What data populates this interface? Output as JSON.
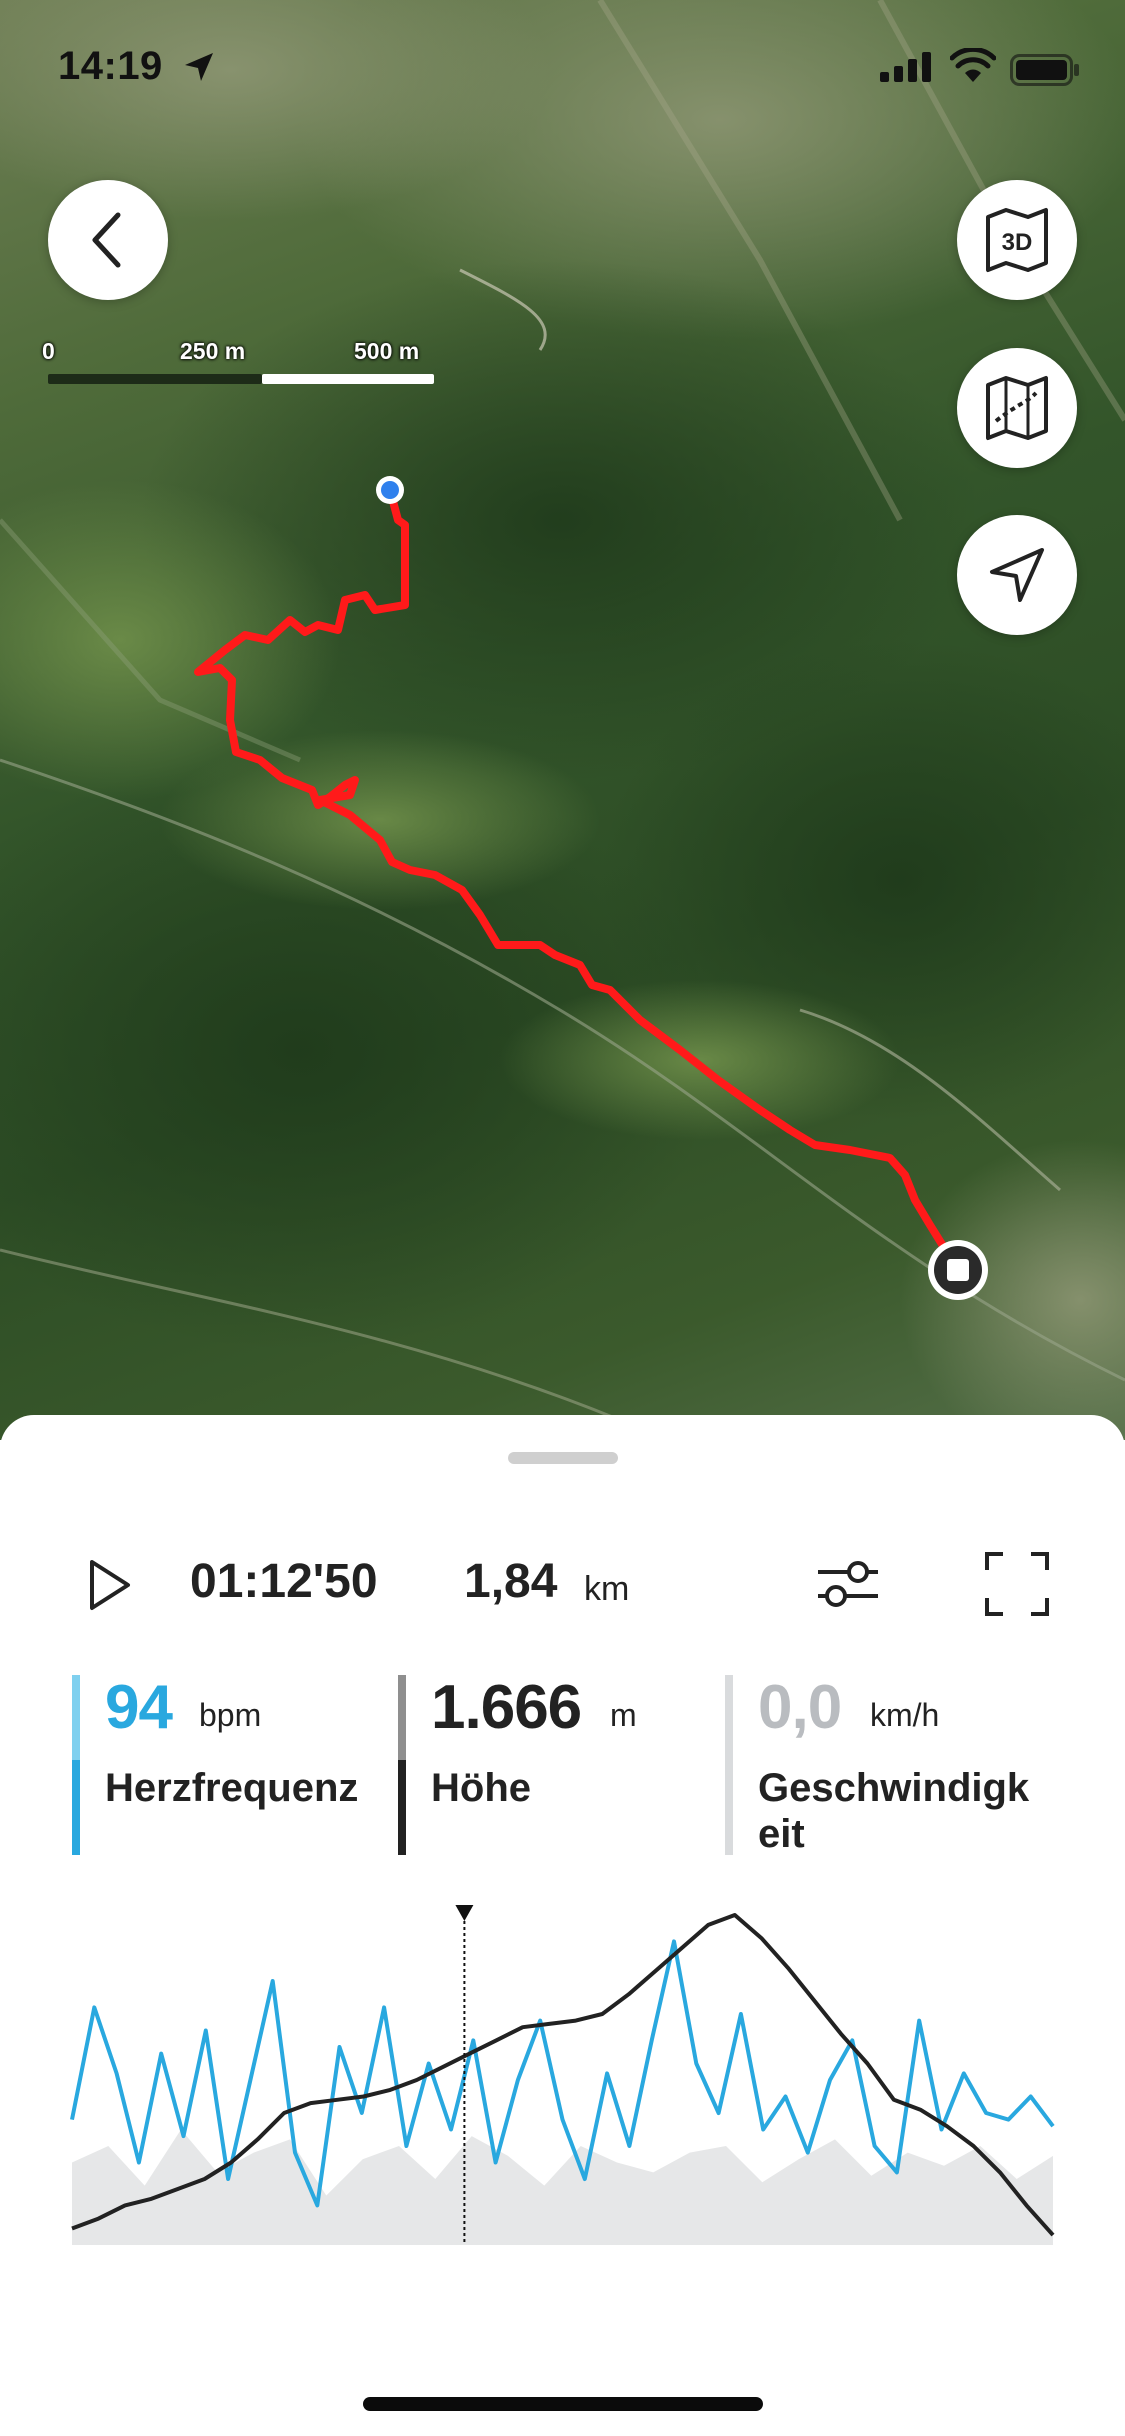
{
  "status_bar": {
    "time": "14:19",
    "location_icon": "location-arrow-icon",
    "signal_icon": "cellular-signal-icon",
    "wifi_icon": "wifi-icon",
    "battery_icon": "battery-icon"
  },
  "map": {
    "back_icon": "chevron-left-icon",
    "button_3d_label": "3D",
    "map_type_icon": "map-icon",
    "locate_icon": "navigation-arrow-icon",
    "scale_labels": [
      "0",
      "250 m",
      "500 m"
    ],
    "route_color": "#ff1a1a",
    "start_marker_color": "#2f80ed",
    "end_marker_icon": "stop-icon"
  },
  "playback": {
    "play_icon": "play-icon",
    "duration": "01:12'50",
    "distance": "1,84",
    "distance_unit": "km",
    "settings_icon": "sliders-icon",
    "fullscreen_icon": "fullscreen-icon"
  },
  "metrics": [
    {
      "value": "94",
      "unit": "bpm",
      "label": "Herzfrequenz",
      "color": "#29a8df"
    },
    {
      "value": "1.666",
      "unit": "m",
      "label": "Höhe",
      "color": "#222222"
    },
    {
      "value": "0,0",
      "unit": "km/h",
      "label": "Geschwindigkeit",
      "color": "#b9bcc0"
    }
  ],
  "chart_data": {
    "type": "line",
    "series": [
      {
        "values": [
          0.05,
          0.08,
          0.12,
          0.14,
          0.17,
          0.2,
          0.25,
          0.32,
          0.4,
          0.43,
          0.44,
          0.45,
          0.47,
          0.5,
          0.54,
          0.58,
          0.62,
          0.66,
          0.67,
          0.68,
          0.7,
          0.76,
          0.83,
          0.9,
          0.97,
          1.0,
          0.93,
          0.84,
          0.74,
          0.64,
          0.55,
          0.44,
          0.41,
          0.36,
          0.3,
          0.22,
          0.12,
          0.03
        ]
      },
      {
        "values": [
          0.38,
          0.72,
          0.52,
          0.25,
          0.58,
          0.33,
          0.65,
          0.2,
          0.5,
          0.8,
          0.28,
          0.12,
          0.6,
          0.4,
          0.72,
          0.3,
          0.55,
          0.35,
          0.62,
          0.25,
          0.5,
          0.68,
          0.38,
          0.2,
          0.52,
          0.3,
          0.62,
          0.92,
          0.55,
          0.4,
          0.7,
          0.35,
          0.45,
          0.28,
          0.5,
          0.62,
          0.3,
          0.22,
          0.68,
          0.35,
          0.52,
          0.4,
          0.38,
          0.45,
          0.36
        ]
      },
      {
        "values": [
          0.25,
          0.3,
          0.18,
          0.35,
          0.22,
          0.28,
          0.32,
          0.15,
          0.26,
          0.3,
          0.2,
          0.33,
          0.27,
          0.18,
          0.3,
          0.25,
          0.22,
          0.28,
          0.3,
          0.19,
          0.26,
          0.32,
          0.21,
          0.28,
          0.24,
          0.3,
          0.2,
          0.27
        ]
      }
    ],
    "cursor_position": 0.4
  }
}
